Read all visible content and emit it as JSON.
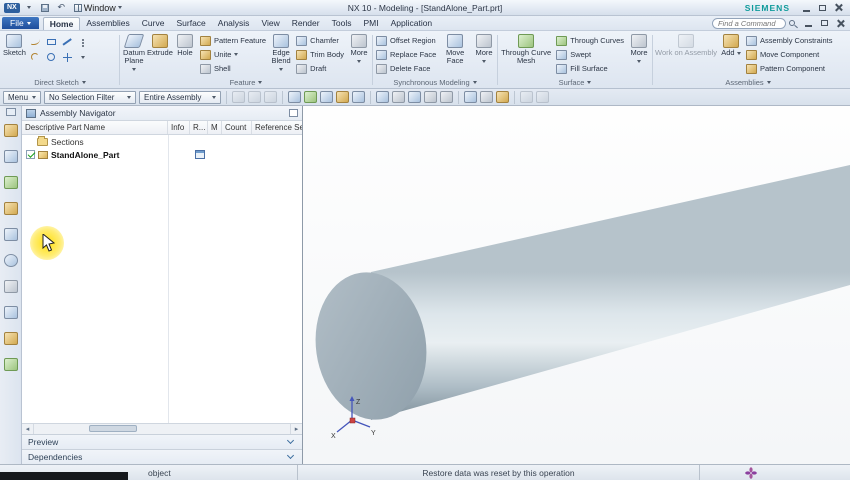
{
  "titlebar": {
    "app_badge": "NX",
    "window_menu": "Window",
    "title": "NX 10 - Modeling - [StandAlone_Part.prt]",
    "brand": "SIEMENS"
  },
  "menubar": {
    "file": "File",
    "tabs": [
      "Home",
      "Assemblies",
      "Curve",
      "Surface",
      "Analysis",
      "View",
      "Render",
      "Tools",
      "PMI",
      "Application"
    ],
    "search_placeholder": "Find a Command"
  },
  "ribbon": {
    "direct_sketch": {
      "label": "Direct Sketch",
      "sketch": "Sketch"
    },
    "feature": {
      "label": "Feature",
      "datum_plane": "Datum Plane",
      "extrude": "Extrude",
      "hole": "Hole",
      "pattern_feature": "Pattern Feature",
      "unite": "Unite",
      "shell": "Shell",
      "edge_blend": "Edge Blend",
      "chamfer": "Chamfer",
      "trim_body": "Trim Body",
      "draft": "Draft",
      "more": "More"
    },
    "synchronous": {
      "label": "Synchronous Modeling",
      "offset_region": "Offset Region",
      "replace_face": "Replace Face",
      "delete_face": "Delete Face",
      "move_face": "Move Face",
      "more": "More"
    },
    "surface": {
      "label": "Surface",
      "through_curve_mesh": "Through Curve Mesh",
      "through_curves": "Through Curves",
      "swept": "Swept",
      "fill_surface": "Fill Surface",
      "more": "More"
    },
    "assemblies": {
      "label": "Assemblies",
      "work_on_assembly": "Work on Assembly",
      "add": "Add",
      "assembly_constraints": "Assembly Constraints",
      "move_component": "Move Component",
      "pattern_component": "Pattern Component"
    }
  },
  "toolbar": {
    "menu": "Menu",
    "selection_filter": "No Selection Filter",
    "selection_scope": "Entire Assembly"
  },
  "navigator": {
    "title": "Assembly Navigator",
    "columns": [
      "Descriptive Part Name",
      "Info",
      "R...",
      "M",
      "Count",
      "Reference Se..."
    ],
    "rows": [
      {
        "name": "Sections"
      },
      {
        "name": "StandAlone_Part"
      }
    ],
    "sections": [
      "Preview",
      "Dependencies"
    ]
  },
  "viewport": {
    "triad": {
      "x": "X",
      "y": "Y",
      "z": "Z"
    },
    "body_gradient": [
      "#b6c3cb",
      "#dde6eb",
      "#e9eff2",
      "#adbcc5",
      "#7d8e99"
    ],
    "cap_gradient": [
      "#aebbc4",
      "#93a3ae"
    ]
  },
  "statusbar": {
    "left": "object",
    "message": "Restore data was reset by this operation"
  },
  "icons": {
    "undo": "↶",
    "scroll_left": "◂",
    "scroll_right": "▸"
  }
}
